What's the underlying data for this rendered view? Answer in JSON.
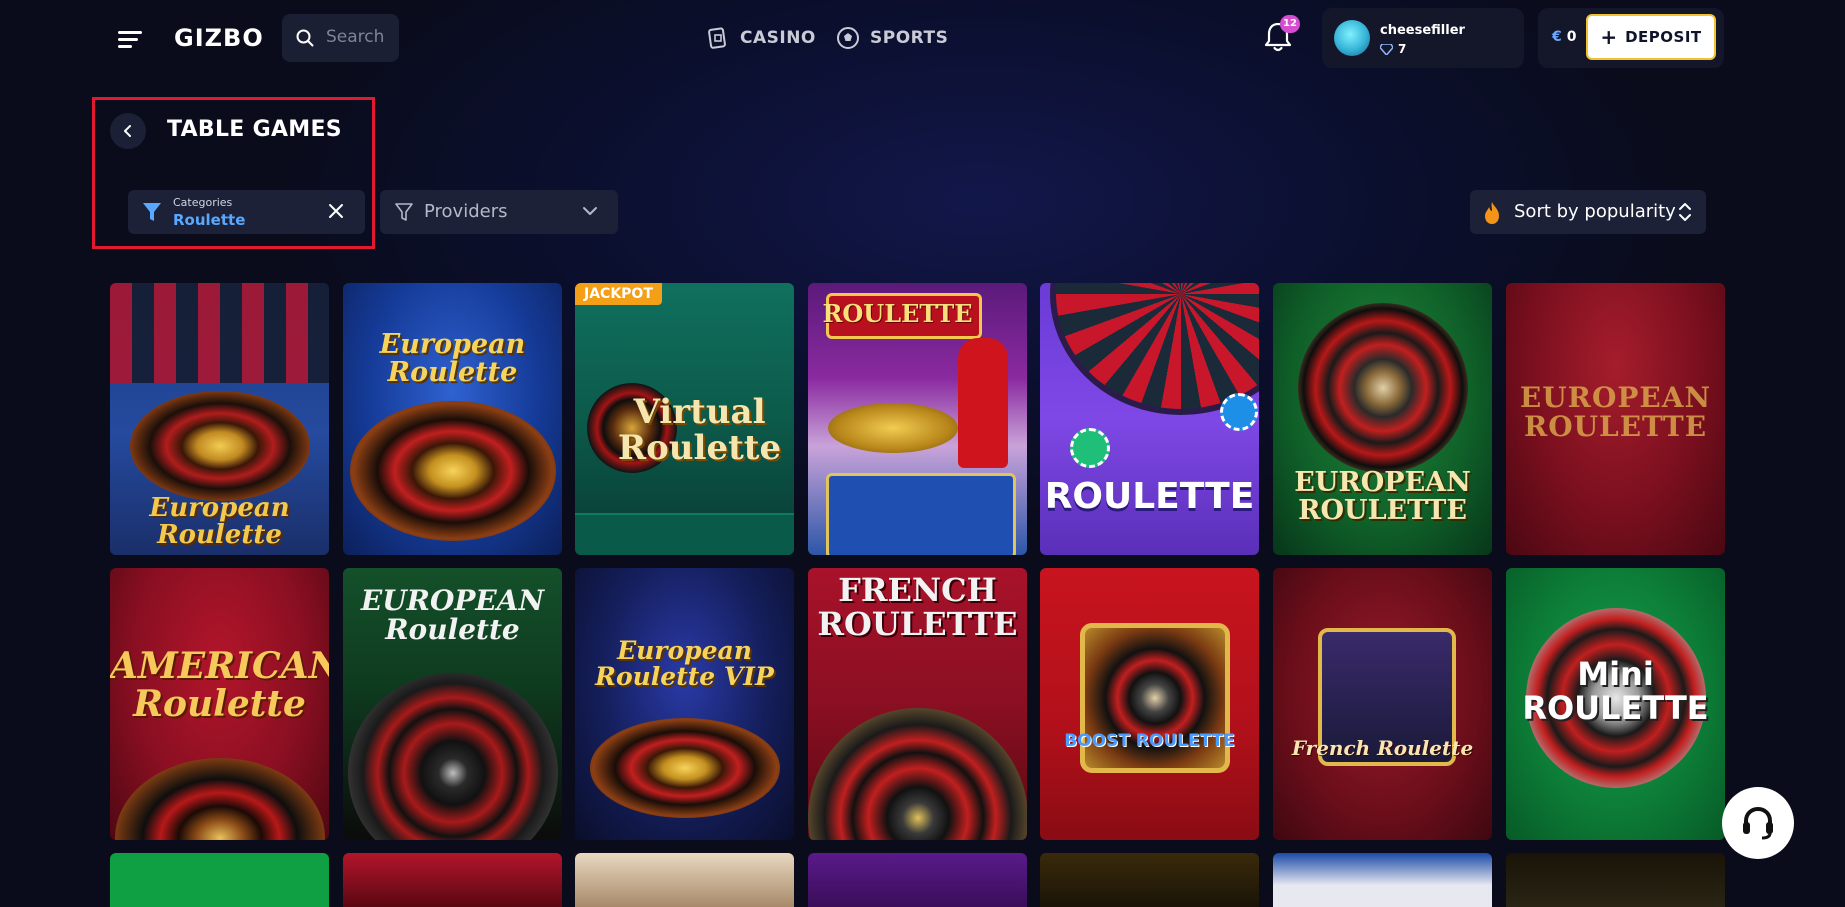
{
  "header": {
    "logo": "GIZBO",
    "search_placeholder": "Search",
    "nav": [
      {
        "label": "CASINO",
        "icon": "casino-cards-icon"
      },
      {
        "label": "SPORTS",
        "icon": "soccer-ball-icon"
      }
    ],
    "notifications_count": "12",
    "user": {
      "name": "cheesefiller",
      "level": "7"
    },
    "balance": {
      "currency": "€",
      "amount": "0"
    },
    "deposit_label": "DEPOSIT"
  },
  "page": {
    "title": "TABLE GAMES",
    "category_filter": {
      "caption": "Categories",
      "value": "Roulette"
    },
    "provider_filter": {
      "label": "Providers"
    },
    "sort": {
      "label": "Sort by popularity"
    }
  },
  "games": {
    "row1": [
      {
        "title": "European Roulette",
        "theme": "blue-red-table"
      },
      {
        "title": "European Roulette",
        "theme": "blue"
      },
      {
        "title": "Virtual Roulette",
        "theme": "teal",
        "badge": "JACKPOT"
      },
      {
        "title": "ROULETTE",
        "theme": "purple-casino"
      },
      {
        "title": "ROULETTE",
        "theme": "purple-wheel"
      },
      {
        "title": "EUROPEAN ROULETTE",
        "theme": "green"
      },
      {
        "title": "EUROPEAN ROULETTE",
        "theme": "dark-red"
      }
    ],
    "row2": [
      {
        "title": "AMERICAN Roulette",
        "theme": "red"
      },
      {
        "title": "EUROPEAN Roulette",
        "theme": "green-black"
      },
      {
        "title": "European Roulette VIP",
        "theme": "dark-blue"
      },
      {
        "title": "FRENCH ROULETTE",
        "theme": "red"
      },
      {
        "title": "BOOST ROULETTE",
        "theme": "red-pattern"
      },
      {
        "title": "French Roulette",
        "theme": "dark-red-pattern"
      },
      {
        "title": "Mini ROULETTE",
        "theme": "green"
      }
    ]
  },
  "colors": {
    "accent_blue": "#59a8ff",
    "deposit_border": "#f2c230",
    "jackpot": "#f3a018",
    "highlight_box": "#e11a2f"
  }
}
